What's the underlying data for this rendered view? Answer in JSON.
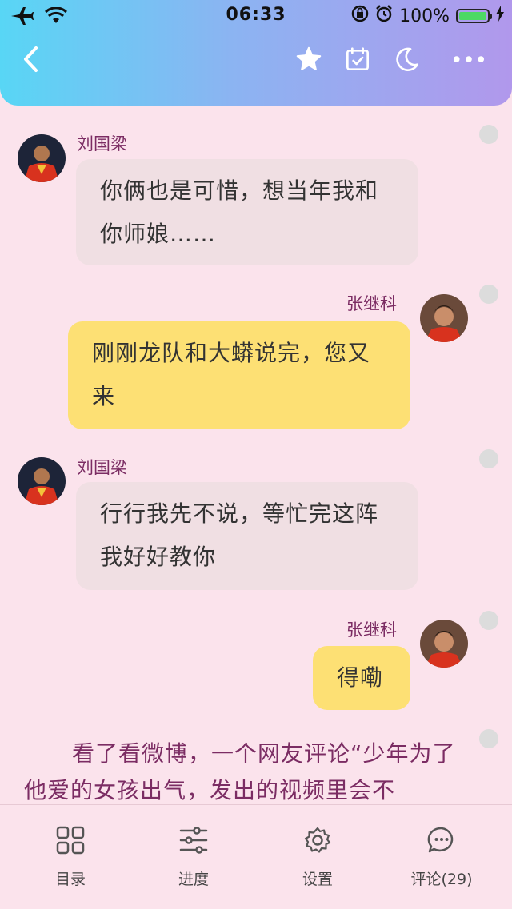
{
  "status_bar": {
    "time": "06:33",
    "battery_percent": "100%",
    "battery_level": 1.0
  },
  "chat": [
    {
      "side": "left",
      "name": "刘国梁",
      "lines": [
        "你俩也是可惜，想当年我和",
        "你师娘……"
      ]
    },
    {
      "side": "right",
      "name": "张继科",
      "lines": [
        "刚刚龙队和大蟒说完，您又",
        "来"
      ]
    },
    {
      "side": "left",
      "name": "刘国梁",
      "lines": [
        "行行我先不说，等忙完这阵",
        "我好好教你"
      ]
    },
    {
      "side": "right",
      "name": "张继科",
      "lines": [
        "得嘞"
      ]
    }
  ],
  "paragraph": "看了看微博，一个网友评论“少年为了他爱的女孩出气，发出的视频里会不",
  "tabs": [
    {
      "icon": "grid-icon",
      "label": "目录"
    },
    {
      "icon": "sliders-icon",
      "label": "进度"
    },
    {
      "icon": "gear-icon",
      "label": "设置"
    },
    {
      "icon": "comment-icon",
      "label": "评论(29)"
    }
  ],
  "colors": {
    "accent_text": "#7b2c63",
    "bubble_left": "#f0dfe3",
    "bubble_right": "#fde074",
    "background": "#fbe3ec"
  }
}
